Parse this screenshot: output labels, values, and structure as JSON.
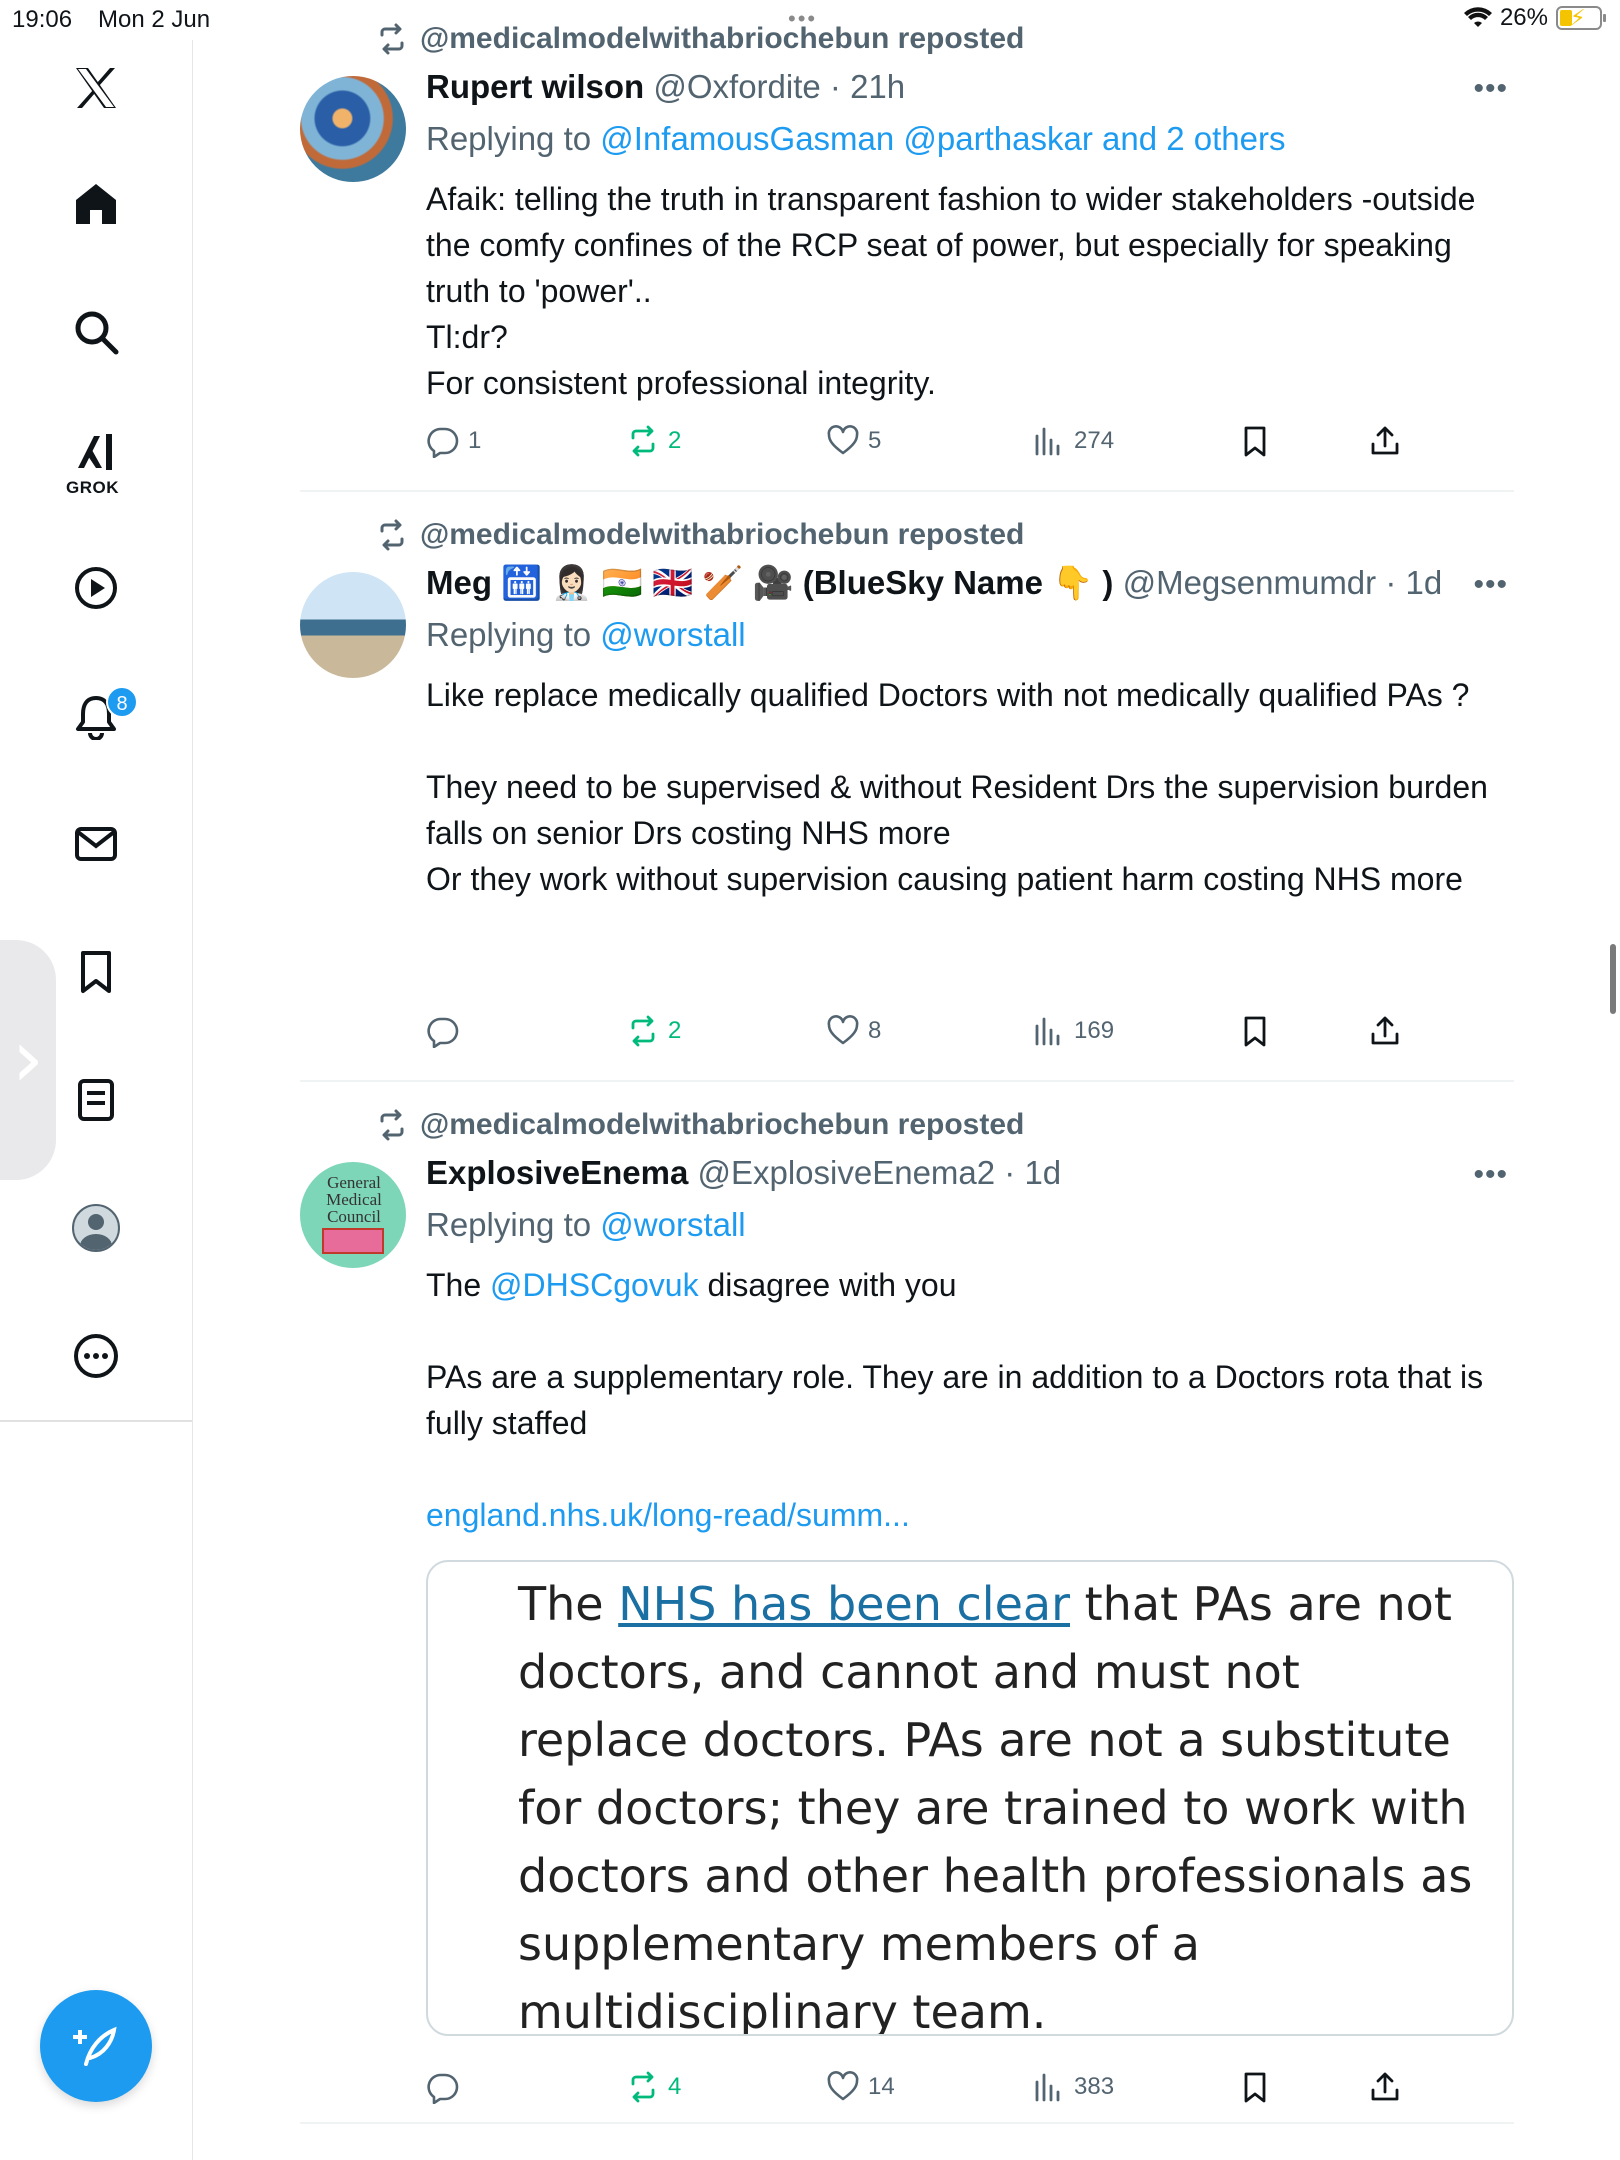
{
  "status_bar": {
    "time": "19:06",
    "date": "Mon 2 Jun",
    "battery": "26%",
    "battery_level": 0.26
  },
  "sidebar": {
    "items": [
      "home",
      "search",
      "grok",
      "videos",
      "notifications",
      "messages",
      "bookmarks",
      "lists",
      "profile",
      "more"
    ],
    "grok_label": "GROK",
    "notifications_badge": "8"
  },
  "tweets": [
    {
      "reposted_by": "@medicalmodelwithabriochebun reposted",
      "name": "Rupert wilson",
      "handle": "@Oxfordite",
      "time": "· 21h",
      "replying_prefix": "Replying to",
      "replying_targets": "@InfamousGasman @parthaskar and 2 others",
      "body": [
        "Afaik: telling the truth in transparent fashion to wider stakeholders -outside the comfy confines of the RCP seat of power, but especially for speaking truth to 'power'..",
        "Tl:dr?",
        "For consistent professional integrity."
      ],
      "replies": "1",
      "reposts": "2",
      "likes": "5",
      "views": "274"
    },
    {
      "reposted_by": "@medicalmodelwithabriochebun reposted",
      "name": "Meg 🛗 👩🏻‍⚕️ 🇮🇳 🇬🇧 🏏 🎥 (BlueSky Name 👇 )",
      "handle": "@Megsenmumdr",
      "time": "· 1d",
      "replying_prefix": "Replying to",
      "replying_targets": "@worstall",
      "body": [
        "Like replace medically qualified Doctors with  not medically qualified PAs ?",
        "",
        "They need to be supervised & without Resident Drs the supervision burden falls on senior Drs costing NHS more",
        "Or they work without supervision causing patient harm costing NHS more"
      ],
      "replies": "",
      "reposts": "2",
      "likes": "8",
      "views": "169"
    },
    {
      "reposted_by": "@medicalmodelwithabriochebun reposted",
      "name": "ExplosiveEnema",
      "handle": "@ExplosiveEnema2",
      "time": "· 1d",
      "replying_prefix": "Replying to",
      "replying_targets": "@worstall",
      "body_prefix": "The",
      "body_mention": "@DHSCgovuk",
      "body_suffix": "disagree with you",
      "body_para2": "PAs are a supplementary role. They are in addition to a Doctors rota that is fully staffed",
      "body_link": "england.nhs.uk/long-read/summ...",
      "avatar_text": "General Medical Council",
      "card": {
        "quote_prefix": "The",
        "quote_link": "NHS has been clear",
        "quote_text": "that PAs are not doctors, and cannot and must not replace doctors. PAs are not a substitute for doctors; they are trained to work with doctors and other health professionals as supplementary members of a multidisciplinary team."
      },
      "replies": "",
      "reposts": "4",
      "likes": "14",
      "views": "383"
    }
  ],
  "colors": {
    "accent": "#1d9bf0",
    "repost_green": "#00ba7c",
    "secondary_text": "#536471"
  }
}
